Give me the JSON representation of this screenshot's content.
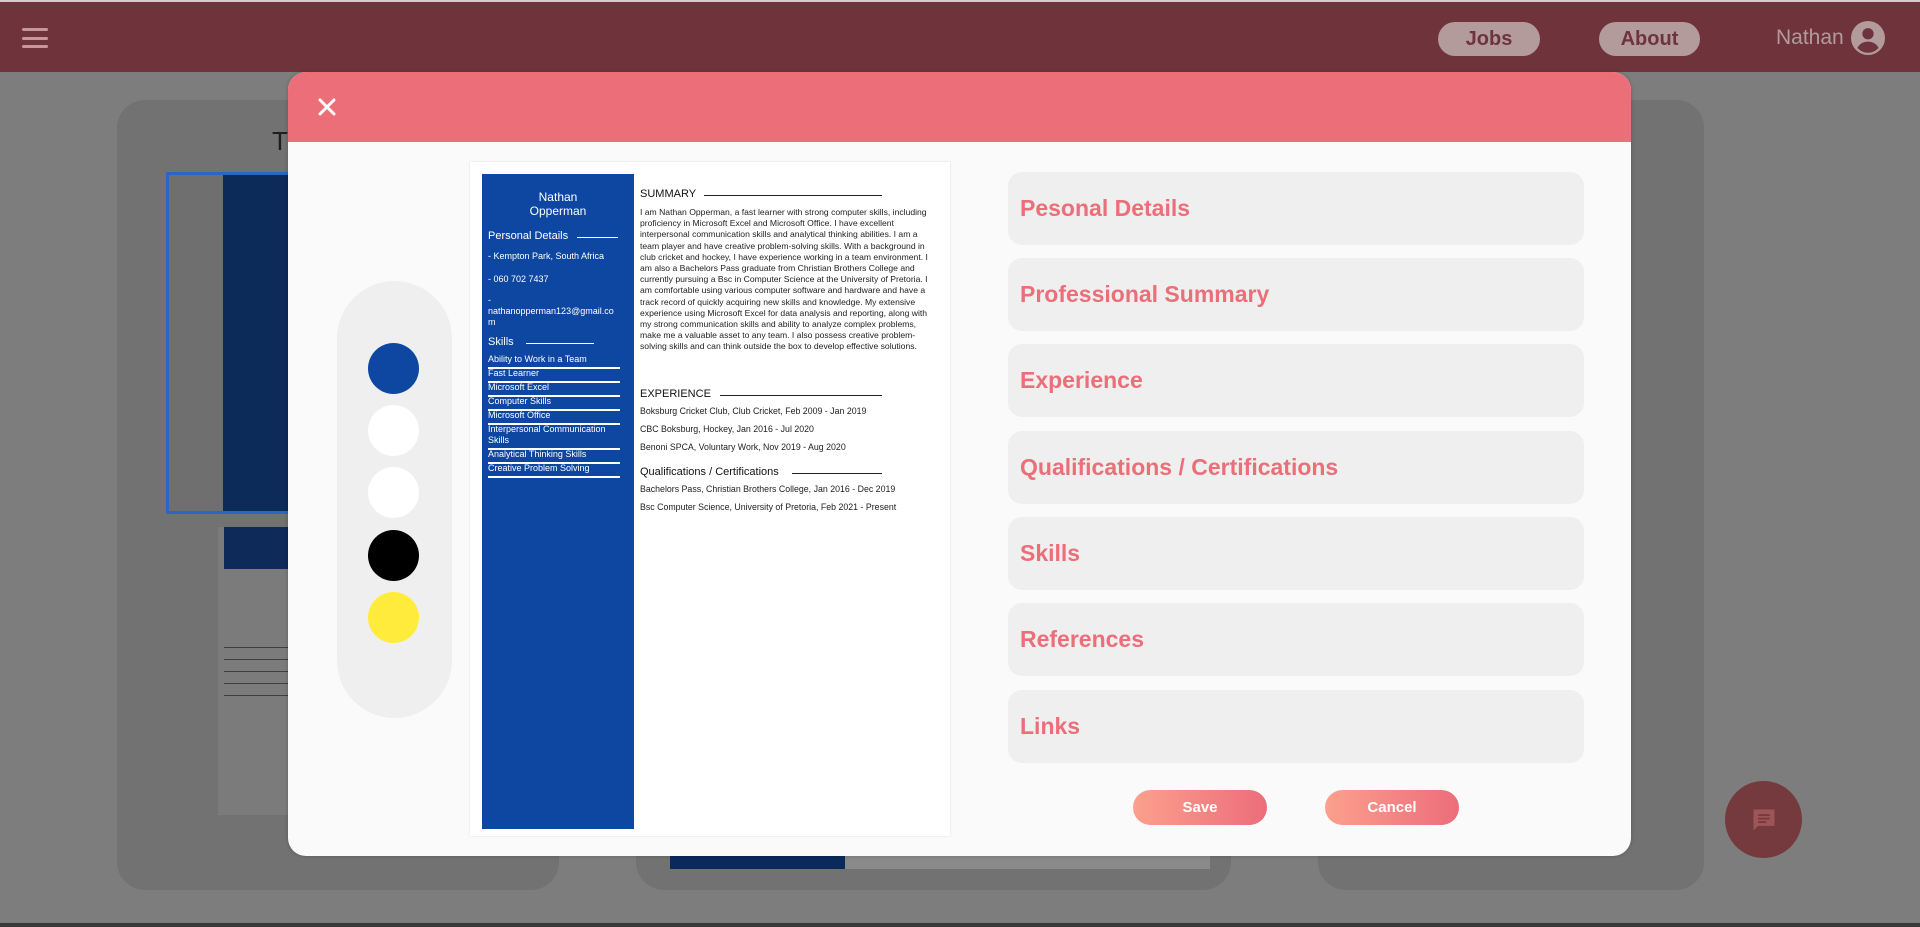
{
  "appbar": {
    "menu_icon": "hamburger-menu-icon",
    "nav": {
      "jobs": "Jobs",
      "about": "About"
    },
    "user": {
      "name": "Nathan",
      "avatar_icon": "account-circle-icon"
    },
    "colors": {
      "bar": "#6f343b",
      "pill": "#b39b9c"
    }
  },
  "background": {
    "title_fragment": "T"
  },
  "modal": {
    "close_icon": "close-icon",
    "accent": "#eb6e79",
    "color_picker": {
      "swatches": [
        {
          "name": "blue",
          "color": "#0d47a1"
        },
        {
          "name": "white",
          "color": "#ffffff"
        },
        {
          "name": "white",
          "color": "#ffffff"
        },
        {
          "name": "black",
          "color": "#000000"
        },
        {
          "name": "yellow",
          "color": "#ffeb3b"
        }
      ]
    },
    "resume": {
      "name_line1": "Nathan",
      "name_line2": "Opperman",
      "personal_details_title": "Personal Details",
      "location": "- Kempton Park, South Africa",
      "phone": "- 060 702 7437",
      "email_dash": "-",
      "email": "nathanopperman123@gmail.co",
      "email_tail": "m",
      "skills_title": "Skills",
      "skills": [
        "Ability to Work in a Team",
        "Fast Learner",
        "Microsoft Excel",
        "Computer Skills",
        "Microsoft Office",
        "Interpersonal Communication Skills",
        "Analytical Thinking Skills",
        "Creative Problem Solving"
      ],
      "summary_title": "SUMMARY",
      "summary_text": "I am Nathan Opperman, a fast learner with strong computer skills, including proficiency in Microsoft Excel and Microsoft Office. I have excellent interpersonal communication skills and analytical thinking abilities. I am a team player and have creative problem-solving skills. With a background in club cricket and hockey, I have experience working in a team environment. I am also a Bachelors Pass graduate from Christian Brothers College and currently pursuing a Bsc in Computer Science at the University of Pretoria. I am comfortable using various computer software and hardware and have a track record of quickly acquiring new skills and knowledge. My extensive experience using Microsoft Excel for data analysis and reporting, along with my strong communication skills and ability to analyze complex problems, make me a valuable asset to any team. I also possess creative problem-solving skills and can think outside the box to develop effective solutions.",
      "experience_title": "EXPERIENCE",
      "experience": [
        "Boksburg Cricket Club, Club Cricket, Feb 2009 - Jan 2019",
        "CBC Boksburg, Hockey, Jan 2016 - Jul 2020",
        "Benoni SPCA, Voluntary Work, Nov 2019 - Aug 2020"
      ],
      "qualifications_title": "Qualifications / Certifications",
      "qualifications": [
        "Bachelors Pass, Christian Brothers College, Jan 2016 - Dec 2019",
        "Bsc Computer Science, University of Pretoria, Feb 2021 - Present"
      ]
    },
    "sections": [
      "Pesonal Details",
      "Professional Summary",
      "Experience",
      "Qualifications / Certifications",
      "Skills",
      "References",
      "Links"
    ],
    "buttons": {
      "save": "Save",
      "cancel": "Cancel"
    }
  },
  "fab": {
    "icon": "chat-message-icon"
  }
}
